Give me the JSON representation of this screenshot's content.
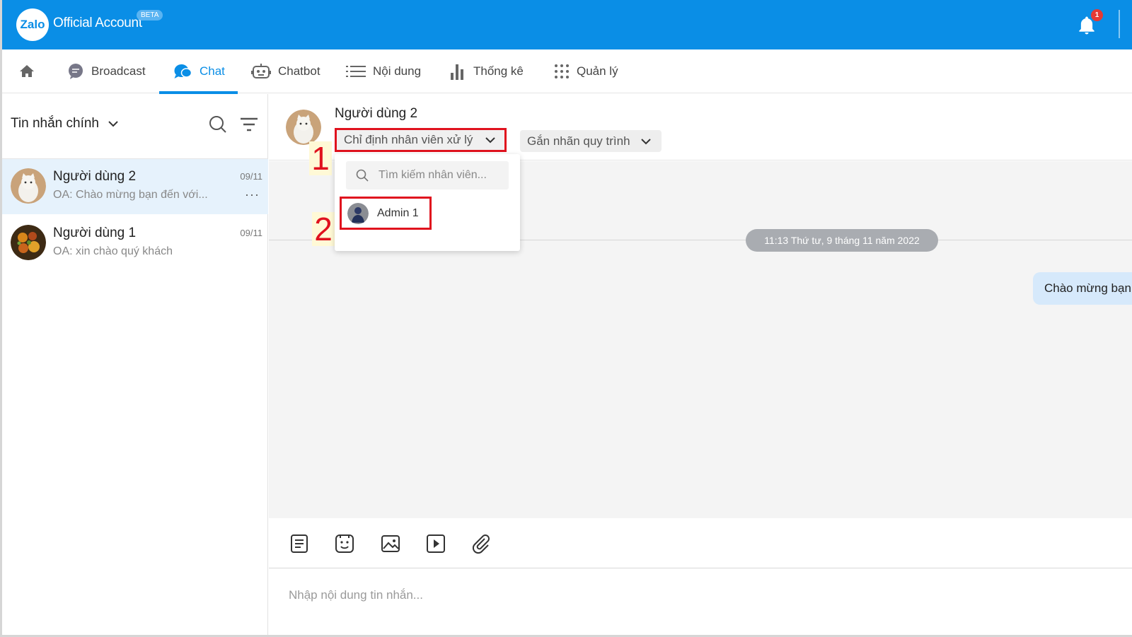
{
  "topbar": {
    "logo_text": "Zalo",
    "brand": "Official Account",
    "beta": "BETA",
    "notification_count": "1",
    "bg_color": "#0a8ee6"
  },
  "nav": {
    "items": [
      {
        "label": "",
        "icon": "home-icon"
      },
      {
        "label": "Broadcast",
        "icon": "broadcast-icon"
      },
      {
        "label": "Chat",
        "icon": "chat-icon",
        "active": true
      },
      {
        "label": "Chatbot",
        "icon": "robot-icon"
      },
      {
        "label": "Nội dung",
        "icon": "list-icon"
      },
      {
        "label": "Thống kê",
        "icon": "bar-chart-icon"
      },
      {
        "label": "Quản lý",
        "icon": "grid-icon"
      }
    ]
  },
  "sidebar": {
    "title": "Tin nhắn chính",
    "conversations": [
      {
        "name": "Người dùng 2",
        "date": "09/11",
        "preview": "OA: Chào mừng bạn đến với...",
        "more": "···"
      },
      {
        "name": "Người dùng 1",
        "date": "09/11",
        "preview": "OA: xin chào quý khách"
      }
    ]
  },
  "chat": {
    "contact_name": "Người dùng 2",
    "assign_label": "Chỉ định nhân viên xử lý",
    "tag_label": "Gắn nhãn quy trình",
    "timestamp": "11:13 Thứ tư, 9 tháng 11 năm 2022",
    "message": "Chào mừng bạn"
  },
  "dropdown": {
    "search_placeholder": "Tìm kiếm nhân viên...",
    "staff": [
      {
        "name": "Admin 1"
      }
    ]
  },
  "annotations": {
    "step1": "1",
    "step2": "2"
  },
  "composer": {
    "placeholder": "Nhập nội dung tin nhắn...",
    "tools": [
      "text-template-icon",
      "sticker-icon",
      "image-icon",
      "video-icon",
      "attachment-icon"
    ]
  }
}
